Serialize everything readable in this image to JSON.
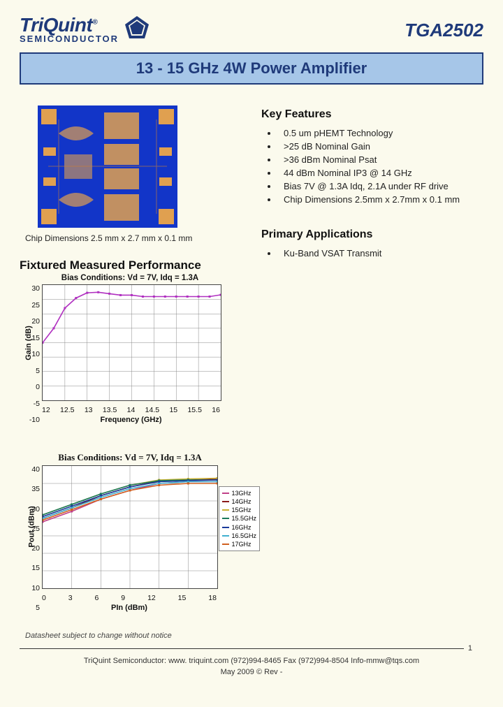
{
  "logo": {
    "name": "TriQuint",
    "sub": "SEMICONDUCTOR"
  },
  "part_number": "TGA2502",
  "title": "13 - 15 GHz 4W Power Amplifier",
  "chip_caption": "Chip Dimensions 2.5 mm x 2.7 mm x 0.1 mm",
  "features_heading": "Key Features",
  "features": [
    "0.5 um pHEMT Technology",
    ">25 dB Nominal Gain",
    ">36 dBm Nominal Psat",
    "44 dBm Nominal IP3 @ 14 GHz",
    "Bias 7V @ 1.3A Idq, 2.1A under RF drive",
    "Chip Dimensions 2.5mm x 2.7mm x 0.1 mm"
  ],
  "fixtured_heading": "Fixtured Measured Performance",
  "apps_heading": "Primary Applications",
  "applications": [
    "Ku-Band VSAT Transmit"
  ],
  "disclaimer": "Datasheet subject to change without notice",
  "page_no": "1",
  "contact": "TriQuint Semiconductor:   www. triquint.com  (972)994-8465  Fax (972)994-8504  Info-mmw@tqs.com",
  "date_line": "May 2009 © Rev -",
  "chart_data": [
    {
      "type": "line",
      "title": "Bias Conditions:  Vd = 7V,  Idq = 1.3A",
      "xlabel": "Frequency (GHz)",
      "ylabel": "Gain (dB)",
      "xlim": [
        12,
        16
      ],
      "ylim": [
        -10,
        30
      ],
      "xticks": [
        "12",
        "12.5",
        "13",
        "13.5",
        "14",
        "14.5",
        "15",
        "15.5",
        "16"
      ],
      "yticks": [
        "30",
        "25",
        "20",
        "15",
        "10",
        "5",
        "0",
        "-5",
        "-10"
      ],
      "x": [
        12,
        12.25,
        12.5,
        12.75,
        13,
        13.25,
        13.5,
        13.75,
        14,
        14.25,
        14.5,
        14.75,
        15,
        15.25,
        15.5,
        15.75,
        16
      ],
      "series": [
        {
          "name": "Gain",
          "color": "#b030c0",
          "values": [
            10,
            15,
            22,
            25.5,
            27.3,
            27.5,
            27,
            26.5,
            26.5,
            26,
            26,
            26,
            26,
            26,
            26,
            26,
            26.6
          ]
        }
      ]
    },
    {
      "type": "line",
      "title": "Bias Conditions: Vd = 7V, Idq = 1.3A",
      "xlabel": "PIn (dBm)",
      "ylabel": "Pout (dBm)",
      "xlim": [
        0,
        18
      ],
      "ylim": [
        5,
        40
      ],
      "xticks": [
        "0",
        "3",
        "6",
        "9",
        "12",
        "15",
        "18"
      ],
      "yticks": [
        "40",
        "35",
        "30",
        "25",
        "20",
        "15",
        "10",
        "5"
      ],
      "x": [
        0,
        3,
        6,
        9,
        12,
        15,
        18
      ],
      "series": [
        {
          "name": "13GHz",
          "color": "#c04088",
          "values": [
            24,
            27,
            30.5,
            33,
            35,
            35.5,
            35.5
          ]
        },
        {
          "name": "14GHz",
          "color": "#8b1a1a",
          "values": [
            25,
            28,
            31.5,
            34,
            35.7,
            36,
            36.2
          ]
        },
        {
          "name": "15GHz",
          "color": "#c8b030",
          "values": [
            26,
            29,
            32,
            34.5,
            36,
            36.3,
            36.5
          ]
        },
        {
          "name": "15.5GHz",
          "color": "#1a7a5a",
          "values": [
            26,
            29,
            32,
            34.5,
            35.8,
            36,
            36
          ]
        },
        {
          "name": "16GHz",
          "color": "#1a3a9a",
          "values": [
            25.5,
            28.5,
            31.5,
            34,
            35.5,
            35.8,
            36
          ]
        },
        {
          "name": "16.5GHz",
          "color": "#40b0d0",
          "values": [
            25,
            28,
            31,
            33.5,
            35,
            35.5,
            35.5
          ]
        },
        {
          "name": "17GHz",
          "color": "#d06020",
          "values": [
            24.5,
            27.5,
            30.5,
            33,
            34.5,
            35,
            35
          ]
        }
      ]
    }
  ]
}
